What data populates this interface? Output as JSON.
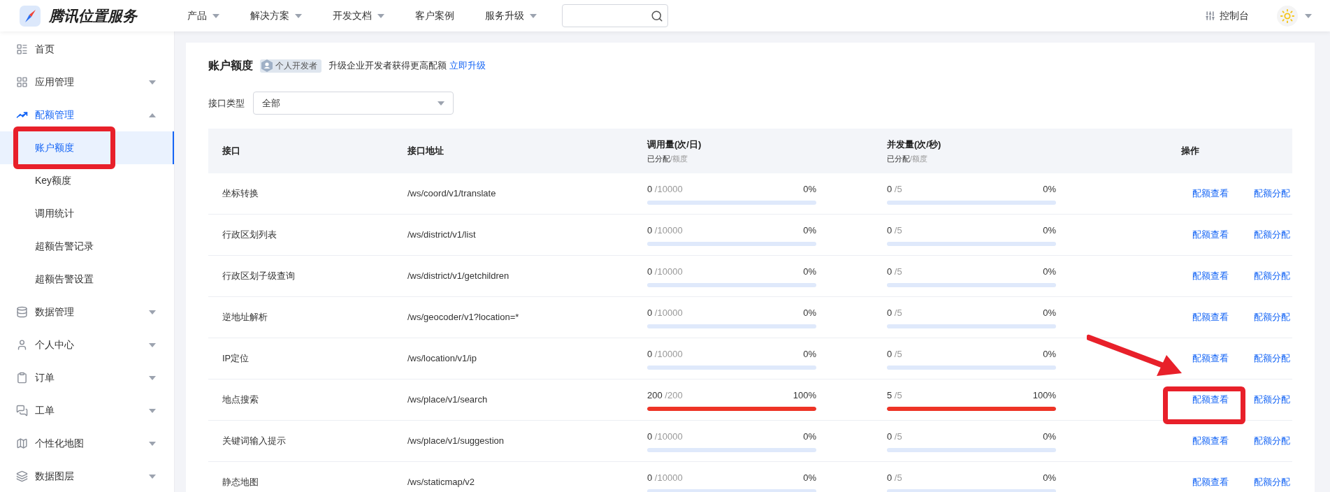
{
  "header": {
    "brand": "腾讯位置服务",
    "nav": [
      {
        "label": "产品",
        "dropdown": true
      },
      {
        "label": "解决方案",
        "dropdown": true
      },
      {
        "label": "开发文档",
        "dropdown": true
      },
      {
        "label": "客户案例",
        "dropdown": false
      },
      {
        "label": "服务升级",
        "dropdown": true
      }
    ],
    "console": "控制台"
  },
  "sidebar": {
    "items": [
      {
        "label": "首页",
        "selected": false
      },
      {
        "label": "应用管理",
        "selected": false,
        "expanded": false
      },
      {
        "label": "配额管理",
        "selected": true,
        "expanded": true,
        "children": [
          {
            "label": "账户额度",
            "selected": true
          },
          {
            "label": "Key额度",
            "selected": false
          },
          {
            "label": "调用统计",
            "selected": false
          },
          {
            "label": "超额告警记录",
            "selected": false
          },
          {
            "label": "超额告警设置",
            "selected": false
          }
        ]
      },
      {
        "label": "数据管理",
        "selected": false,
        "expanded": false
      },
      {
        "label": "个人中心",
        "selected": false,
        "expanded": false
      },
      {
        "label": "订单",
        "selected": false,
        "expanded": false
      },
      {
        "label": "工单",
        "selected": false,
        "expanded": false
      },
      {
        "label": "个性化地图",
        "selected": false,
        "expanded": false
      },
      {
        "label": "数据图层",
        "selected": false,
        "expanded": false
      }
    ]
  },
  "page": {
    "title": "账户额度",
    "badge": "个人开发者",
    "notice": "升级企业开发者获得更高配额",
    "upgrade_link": "立即升级",
    "filter": {
      "label": "接口类型",
      "value": "全部"
    }
  },
  "table": {
    "columns": [
      {
        "title": "接口"
      },
      {
        "title": "接口地址"
      },
      {
        "title": "调用量(次/日)",
        "sub_allocated": "已分配",
        "sub_quota": "/额度"
      },
      {
        "title": "并发量(次/秒)",
        "sub_allocated": "已分配",
        "sub_quota": "/额度"
      },
      {
        "title": "操作"
      }
    ],
    "rows": [
      {
        "name": "坐标转换",
        "path": "/ws/coord/v1/translate",
        "calls": {
          "used": "0",
          "quota": "/10000",
          "percent": "0%",
          "level": 0
        },
        "concurrency": {
          "used": "0",
          "quota": "/5",
          "percent": "0%",
          "level": 0
        },
        "actions": [
          "配额查看",
          "配额分配"
        ]
      },
      {
        "name": "行政区划列表",
        "path": "/ws/district/v1/list",
        "calls": {
          "used": "0",
          "quota": "/10000",
          "percent": "0%",
          "level": 0
        },
        "concurrency": {
          "used": "0",
          "quota": "/5",
          "percent": "0%",
          "level": 0
        },
        "actions": [
          "配额查看",
          "配额分配"
        ]
      },
      {
        "name": "行政区划子级查询",
        "path": "/ws/district/v1/getchildren",
        "calls": {
          "used": "0",
          "quota": "/10000",
          "percent": "0%",
          "level": 0
        },
        "concurrency": {
          "used": "0",
          "quota": "/5",
          "percent": "0%",
          "level": 0
        },
        "actions": [
          "配额查看",
          "配额分配"
        ]
      },
      {
        "name": "逆地址解析",
        "path": "/ws/geocoder/v1?location=*",
        "calls": {
          "used": "0",
          "quota": "/10000",
          "percent": "0%",
          "level": 0
        },
        "concurrency": {
          "used": "0",
          "quota": "/5",
          "percent": "0%",
          "level": 0
        },
        "actions": [
          "配额查看",
          "配额分配"
        ]
      },
      {
        "name": "IP定位",
        "path": "/ws/location/v1/ip",
        "calls": {
          "used": "0",
          "quota": "/10000",
          "percent": "0%",
          "level": 0
        },
        "concurrency": {
          "used": "0",
          "quota": "/5",
          "percent": "0%",
          "level": 0
        },
        "actions": [
          "配额查看",
          "配额分配"
        ]
      },
      {
        "name": "地点搜索",
        "path": "/ws/place/v1/search",
        "calls": {
          "used": "200",
          "quota": "/200",
          "percent": "100%",
          "level": 1
        },
        "concurrency": {
          "used": "5",
          "quota": "/5",
          "percent": "100%",
          "level": 1
        },
        "actions": [
          "配额查看",
          "配额分配"
        ]
      },
      {
        "name": "关键词输入提示",
        "path": "/ws/place/v1/suggestion",
        "calls": {
          "used": "0",
          "quota": "/10000",
          "percent": "0%",
          "level": 0
        },
        "concurrency": {
          "used": "0",
          "quota": "/5",
          "percent": "0%",
          "level": 0
        },
        "actions": [
          "配额查看",
          "配额分配"
        ]
      },
      {
        "name": "静态地图",
        "path": "/ws/staticmap/v2",
        "calls": {
          "used": "0",
          "quota": "/10000",
          "percent": "0%",
          "level": 0
        },
        "concurrency": {
          "used": "0",
          "quota": "/5",
          "percent": "0%",
          "level": 0
        },
        "actions": [
          "配额查看",
          "配额分配"
        ]
      }
    ]
  }
}
